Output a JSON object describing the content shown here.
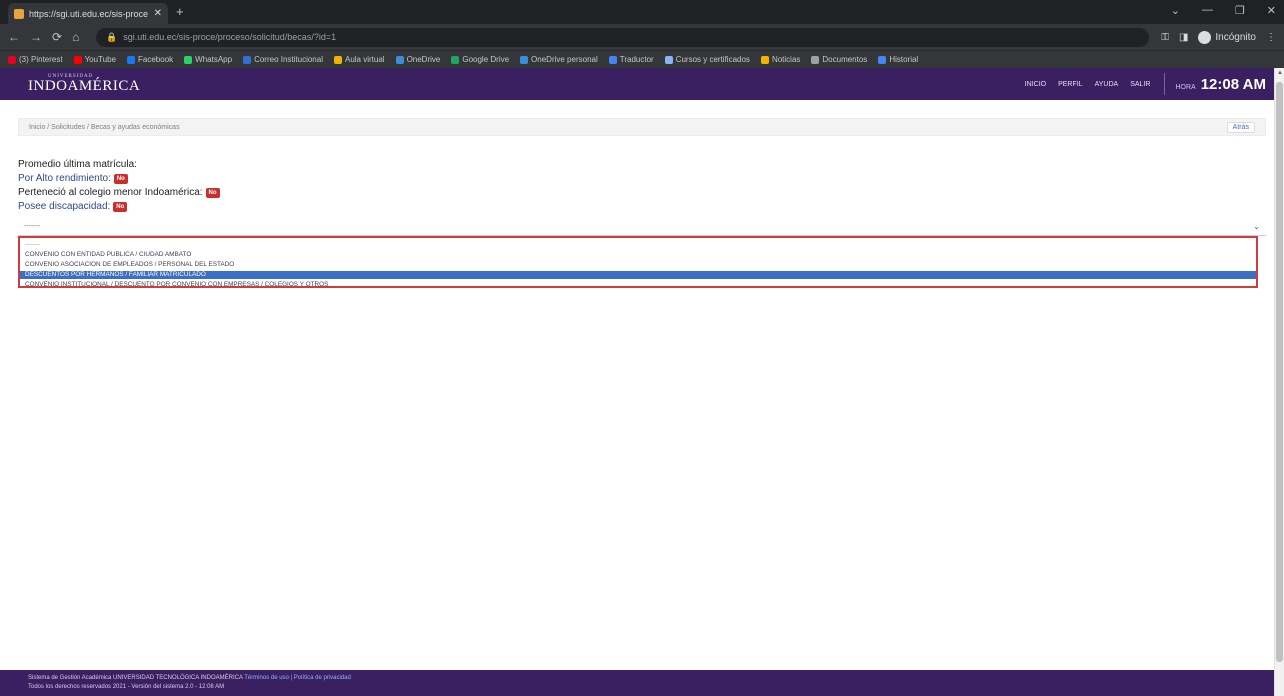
{
  "browser": {
    "tab_title": "https://sgi.uti.edu.ec/sis-proce",
    "tab_close": "✕",
    "new_tab": "+",
    "window_controls": [
      "⌄",
      "—",
      "❐",
      "✕"
    ],
    "nav_icons": [
      "←",
      "→",
      "⟳",
      "⌂"
    ],
    "url": "sgi.uti.edu.ec/sis-proce/proceso/solicitud/becas/?id=1",
    "incognito_label": "Incógnito",
    "bookmarks": [
      {
        "label": "(3) Pinterest",
        "color": "#e60023"
      },
      {
        "label": "YouTube",
        "color": "#ff0000"
      },
      {
        "label": "Facebook",
        "color": "#1877f2"
      },
      {
        "label": "WhatsApp",
        "color": "#25d366"
      },
      {
        "label": "Correo Institucional",
        "color": "#2f6fd6"
      },
      {
        "label": "Aula virtual",
        "color": "#f0b400"
      },
      {
        "label": "OneDrive",
        "color": "#3b8ede"
      },
      {
        "label": "Google Drive",
        "color": "#1fa463"
      },
      {
        "label": "OneDrive personal",
        "color": "#3b8ede"
      },
      {
        "label": "Traductor",
        "color": "#4285f4"
      },
      {
        "label": "Cursos y certificados",
        "color": "#8ab4f8"
      },
      {
        "label": "Noticias",
        "color": "#f4b400"
      },
      {
        "label": "Documentos",
        "color": "#9aa0a6"
      },
      {
        "label": "Historial",
        "color": "#4285f4"
      }
    ]
  },
  "header": {
    "logo_small": "UNIVERSIDAD",
    "logo": "INDOAMÉRICA",
    "links": [
      "INICIO",
      "PERFIL",
      "AYUDA",
      "SALIR"
    ],
    "clock_label": "HORA",
    "clock_time": "12:08 AM"
  },
  "breadcrumb": {
    "path": "Inicio / Solicitudes / Becas y ayudas económicas",
    "back_label": "Atrás"
  },
  "info": {
    "promedio_label": "Promedio última matrícula:",
    "alto_label": "Por Alto rendimiento:",
    "alto_badge": "No",
    "colegio_label": "Perteneció al colegio menor Indoamérica:",
    "colegio_badge": "No",
    "discap_label": "Posee discapacidad:",
    "discap_badge": "No"
  },
  "select": {
    "value": "-------",
    "chevron": "⌄"
  },
  "dropdown": {
    "options": [
      "-------",
      "CONVENIO CON ENTIDAD PÚBLICA / CIUDAD AMBATO",
      "CONVENIO ASOCIACIÓN DE EMPLEADOS / PERSONAL DEL ESTADO",
      "DESCUENTOS POR HERMANOS / FAMILIAR MATRICULADO",
      "CONVENIO INSTITUCIONAL / DESCUENTO POR CONVENIO CON EMPRESAS / COLEGIOS Y OTROS"
    ],
    "selected_index": 3
  },
  "footer": {
    "line1": "Sistema de Gestión Académica UNIVERSIDAD TECNOLÓGICA INDOAMÉRICA",
    "line1_link": "Términos de uso | Política de privacidad",
    "line2": "Todos los derechos reservados 2021 - Versión del sistema 2.0 - 12:08 AM"
  }
}
